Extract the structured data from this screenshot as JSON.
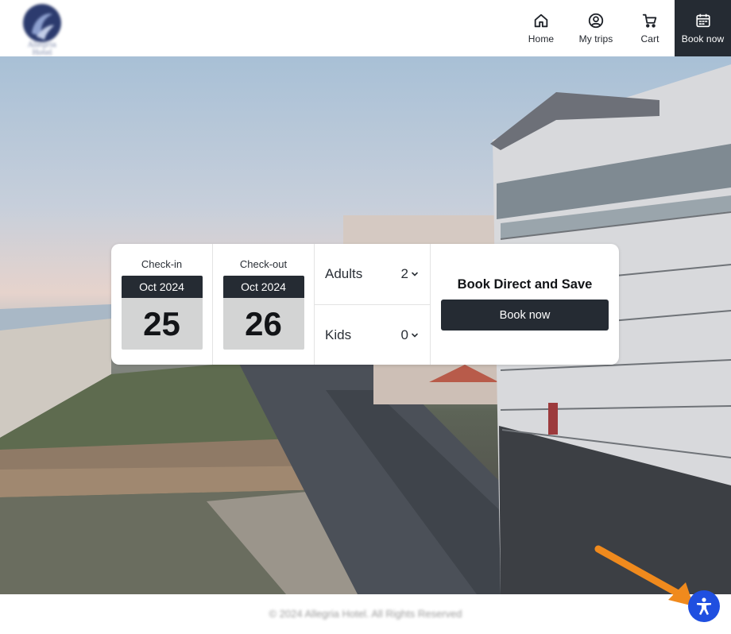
{
  "brand": {
    "logo_text": "Allegria Hotel"
  },
  "nav": {
    "home": {
      "label": "Home",
      "icon": "home-icon"
    },
    "trips": {
      "label": "My trips",
      "icon": "user-circle-icon"
    },
    "cart": {
      "label": "Cart",
      "icon": "cart-icon"
    },
    "book": {
      "label": "Book now",
      "icon": "calendar-icon"
    }
  },
  "booking": {
    "checkin": {
      "label": "Check-in",
      "month": "Oct 2024",
      "day": "25"
    },
    "checkout": {
      "label": "Check-out",
      "month": "Oct 2024",
      "day": "26"
    },
    "adults": {
      "label": "Adults",
      "value": "2"
    },
    "kids": {
      "label": "Kids",
      "value": "0"
    },
    "headline": "Book Direct and Save",
    "button": "Book now"
  },
  "footer": {
    "copyright": "© 2024 Allegria Hotel. All Rights Reserved"
  },
  "colors": {
    "primary": "#252b33",
    "accessibility": "#1f4fe0",
    "arrow": "#f08a1d"
  },
  "accessibility": {
    "icon": "accessibility-icon"
  }
}
